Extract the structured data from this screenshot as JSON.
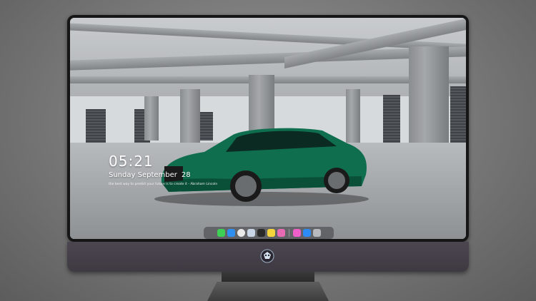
{
  "lockscreen": {
    "time": "05:21",
    "weekday_month": "Sunday September",
    "day": "28",
    "quote": "the best way to predict your future is to create it - Abraham Lincoln"
  },
  "dock": {
    "apps": [
      {
        "icon": "messages-icon",
        "color": "#3ecf55"
      },
      {
        "icon": "finder-icon",
        "color": "#2f8ff0"
      },
      {
        "icon": "safari-icon",
        "color": "#e9e9e9"
      },
      {
        "icon": "preview-icon",
        "color": "#c9d6e8"
      },
      {
        "icon": "claquette-icon",
        "color": "#2a2a2a"
      },
      {
        "icon": "notes-icon",
        "color": "#f6d43c"
      },
      {
        "icon": "photos-icon",
        "color": "#e86ab4"
      },
      {
        "icon": "music-icon",
        "color": "#ee5fc9"
      },
      {
        "icon": "appstore-icon",
        "color": "#2d8bf5"
      },
      {
        "icon": "screenshot-icon",
        "color": "#b6b9bd"
      }
    ]
  },
  "colors": {
    "car": "#0e6e4e",
    "bezel": "#161616",
    "chin": "#46414b"
  }
}
